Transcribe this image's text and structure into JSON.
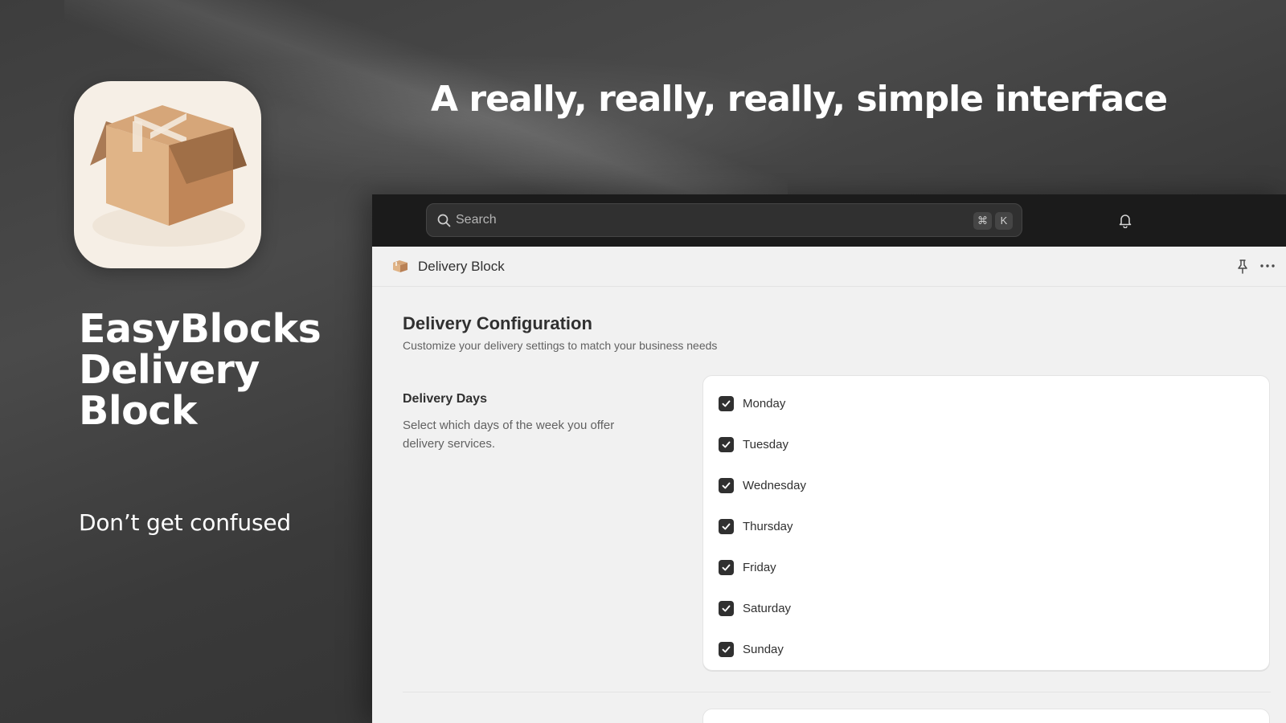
{
  "hero": {
    "headline": "A really, really, really, simple interface",
    "brand_title": "EasyBlocks Delivery Block",
    "tagline": "Don’t get confused"
  },
  "topbar": {
    "search_placeholder": "Search",
    "shortcut_keys": [
      "⌘",
      "K"
    ]
  },
  "page": {
    "title": "Delivery Block"
  },
  "config": {
    "title": "Delivery Configuration",
    "subtitle": "Customize your delivery settings to match your business needs",
    "delivery_days": {
      "title": "Delivery Days",
      "description": "Select which days of the week you offer delivery services.",
      "days": [
        {
          "label": "Monday",
          "checked": true
        },
        {
          "label": "Tuesday",
          "checked": true
        },
        {
          "label": "Wednesday",
          "checked": true
        },
        {
          "label": "Thursday",
          "checked": true
        },
        {
          "label": "Friday",
          "checked": true
        },
        {
          "label": "Saturday",
          "checked": true
        },
        {
          "label": "Sunday",
          "checked": true
        }
      ]
    }
  },
  "colors": {
    "topbar_bg": "#1b1b1b",
    "checkbox": "#303030",
    "page_bg": "#f1f1f1"
  }
}
